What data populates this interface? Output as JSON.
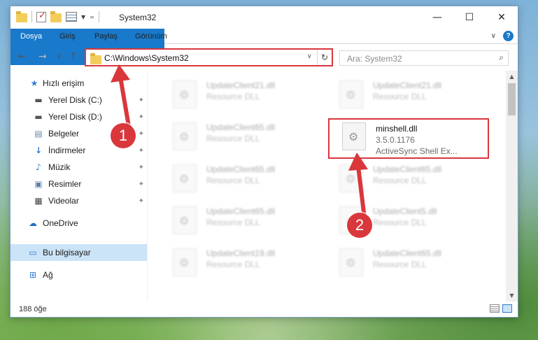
{
  "window": {
    "title": "System32",
    "controls": {
      "minimize": "—",
      "maximize": "☐",
      "close": "✕"
    }
  },
  "ribbon": {
    "tabs": [
      "Dosya",
      "Giriş",
      "Paylaş",
      "Görünüm"
    ],
    "help": "?"
  },
  "address": {
    "path": "C:\\Windows\\System32",
    "search_placeholder": "Ara: System32"
  },
  "sidebar": {
    "items": [
      {
        "label": "Hızlı erişim",
        "icon": "star-icon"
      },
      {
        "label": "Yerel Disk (C:)",
        "icon": "drive-icon",
        "pinned": true
      },
      {
        "label": "Yerel Disk (D:)",
        "icon": "drive-icon",
        "pinned": true
      },
      {
        "label": "Belgeler",
        "icon": "documents-icon",
        "pinned": true
      },
      {
        "label": "İndirmeler",
        "icon": "download-icon",
        "pinned": true
      },
      {
        "label": "Müzik",
        "icon": "music-icon",
        "pinned": true
      },
      {
        "label": "Resimler",
        "icon": "pictures-icon",
        "pinned": true
      },
      {
        "label": "Videolar",
        "icon": "videos-icon",
        "pinned": true
      },
      {
        "label": "OneDrive",
        "icon": "cloud-icon"
      },
      {
        "label": "Bu bilgisayar",
        "icon": "computer-icon",
        "selected": true
      },
      {
        "label": "Ağ",
        "icon": "network-icon"
      }
    ]
  },
  "files": {
    "left": [
      {
        "name": "UpdateClient21.dll",
        "type": "Resource DLL"
      },
      {
        "name": "UpdateClient65.dll",
        "type": "Resource DLL"
      },
      {
        "name": "UpdateClient65.dll",
        "type": "Resource DLL"
      },
      {
        "name": "UpdateClient65.dll",
        "type": "Resource DLL"
      },
      {
        "name": "UpdateClient19.dll",
        "type": "Resource DLL"
      }
    ],
    "right": [
      {
        "name": "UpdateClient21.dll",
        "type": "Resource DLL"
      },
      {
        "name": "minshell.dll",
        "version": "3.5.0.1176",
        "desc": "ActiveSync Shell Ex..."
      },
      {
        "name": "UpdateClient65.dll",
        "type": "Resource DLL"
      },
      {
        "name": "UpdateClient5.dll",
        "type": "Resource DLL"
      },
      {
        "name": "UpdateClient65.dll",
        "type": "Resource DLL"
      }
    ]
  },
  "status": {
    "count": "188 öğe"
  },
  "annotations": {
    "step1": "1",
    "step2": "2"
  },
  "colors": {
    "accent": "#1979ca",
    "highlight": "#d9373c"
  }
}
